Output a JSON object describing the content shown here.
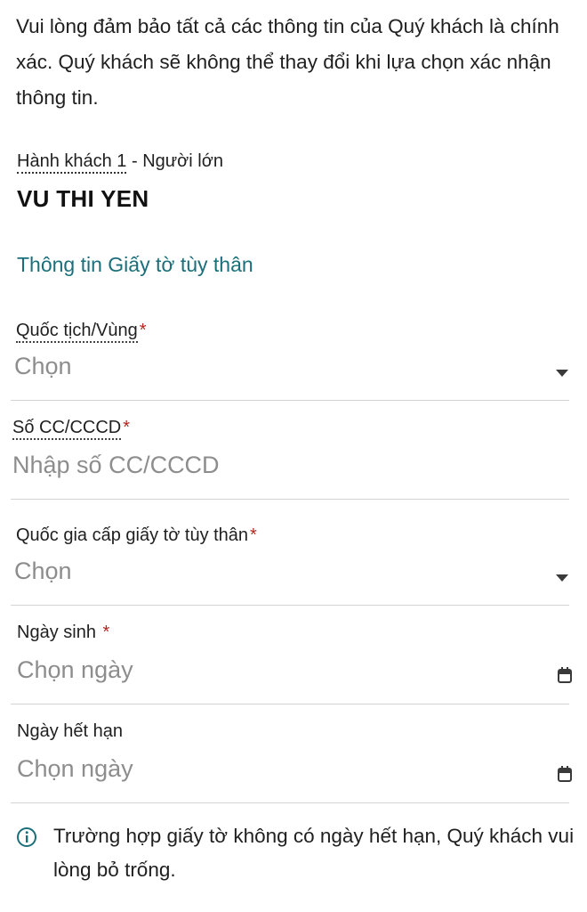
{
  "intro_text": "Vui lòng đảm bảo tất cả các thông tin của Quý khách là chính xác. Quý khách sẽ không thể thay đổi khi lựa chọn xác nhận thông tin.",
  "passenger": {
    "label_main": "Hành khách 1",
    "label_suffix": " - Người lớn",
    "name": "VU THI YEN"
  },
  "section_title": "Thông tin Giấy tờ tùy thân",
  "fields": {
    "nationality": {
      "label": "Quốc tịch/Vùng",
      "required_mark": "*",
      "value": "Chọn",
      "icon": "chevron-down-icon"
    },
    "id_number": {
      "label": "Số CC/CCCD",
      "required_mark": "*",
      "placeholder": "Nhập số CC/CCCD"
    },
    "issuing_country": {
      "label": "Quốc gia cấp giấy tờ tùy thân",
      "required_mark": "*",
      "value": "Chọn",
      "icon": "chevron-down-icon"
    },
    "birth_date": {
      "label": "Ngày sinh ",
      "required_mark": "*",
      "value": "Chọn ngày",
      "icon": "calendar-icon"
    },
    "expiry_date": {
      "label": "Ngày hết hạn",
      "value": "Chọn ngày",
      "icon": "calendar-icon"
    }
  },
  "note": {
    "icon": "info-icon",
    "text": "Trường hợp giấy tờ không có ngày hết hạn, Quý khách vui lòng bỏ trống."
  },
  "colors": {
    "accent_teal": "#1b6f7a",
    "required_red": "#b3261e",
    "placeholder_gray": "#8d8d8d",
    "divider": "#d4d4d4"
  }
}
